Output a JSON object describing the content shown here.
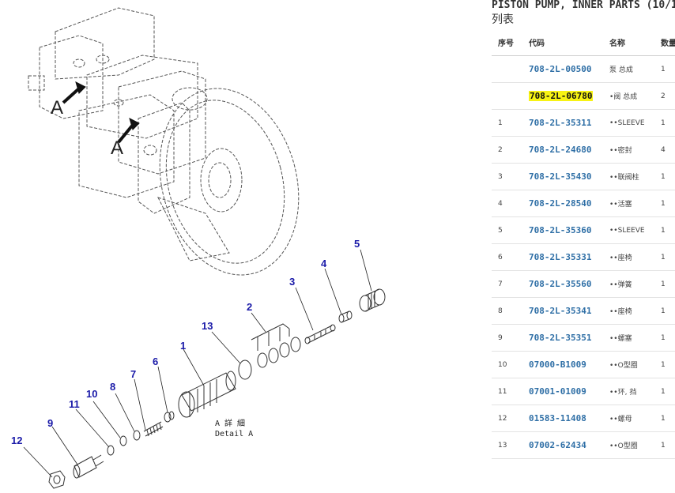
{
  "panel": {
    "title": "PISTON PUMP, INNER PARTS (10/1",
    "subtitle": "列表",
    "headers": {
      "seq": "序号",
      "code": "代码",
      "name": "名称",
      "qty": "数量"
    },
    "rows": [
      {
        "seq": "",
        "code": "708-2L-00500",
        "name": "泵 总成",
        "qty": "1",
        "highlight": false
      },
      {
        "seq": "",
        "code": "708-2L-06780",
        "name": "•阀 总成",
        "qty": "2",
        "highlight": true
      },
      {
        "seq": "1",
        "code": "708-2L-35311",
        "name": "••SLEEVE",
        "qty": "1",
        "highlight": false
      },
      {
        "seq": "2",
        "code": "708-2L-24680",
        "name": "••密封",
        "qty": "4",
        "highlight": false
      },
      {
        "seq": "3",
        "code": "708-2L-35430",
        "name": "••联阀柱",
        "qty": "1",
        "highlight": false
      },
      {
        "seq": "4",
        "code": "708-2L-28540",
        "name": "••活塞",
        "qty": "1",
        "highlight": false
      },
      {
        "seq": "5",
        "code": "708-2L-35360",
        "name": "••SLEEVE",
        "qty": "1",
        "highlight": false
      },
      {
        "seq": "6",
        "code": "708-2L-35331",
        "name": "••座椅",
        "qty": "1",
        "highlight": false
      },
      {
        "seq": "7",
        "code": "708-2L-35560",
        "name": "••弹簧",
        "qty": "1",
        "highlight": false
      },
      {
        "seq": "8",
        "code": "708-2L-35341",
        "name": "••座椅",
        "qty": "1",
        "highlight": false
      },
      {
        "seq": "9",
        "code": "708-2L-35351",
        "name": "••螺塞",
        "qty": "1",
        "highlight": false
      },
      {
        "seq": "10",
        "code": "07000-B1009",
        "name": "••O型圈",
        "qty": "1",
        "highlight": false
      },
      {
        "seq": "11",
        "code": "07001-01009",
        "name": "••环, 挡",
        "qty": "1",
        "highlight": false
      },
      {
        "seq": "12",
        "code": "01583-11408",
        "name": "••螺母",
        "qty": "1",
        "highlight": false
      },
      {
        "seq": "13",
        "code": "07002-62434",
        "name": "••O型圈",
        "qty": "1",
        "highlight": false
      }
    ]
  },
  "diagram": {
    "view_letter": "A",
    "detail_caption_cn": "A 詳 細",
    "detail_caption_en": "Detail A",
    "callouts": [
      "1",
      "2",
      "3",
      "4",
      "5",
      "6",
      "7",
      "8",
      "9",
      "10",
      "11",
      "12",
      "13"
    ]
  },
  "colors": {
    "code_link": "#2f6fa6",
    "highlight": "#f7f214",
    "callout": "#1a1aa8"
  }
}
